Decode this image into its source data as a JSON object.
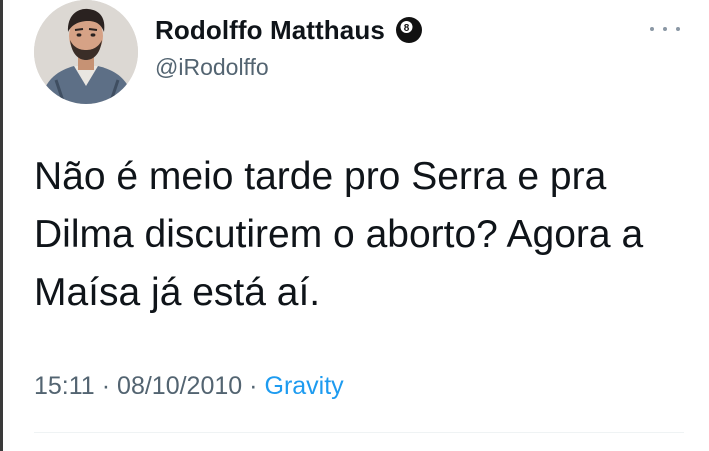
{
  "tweet": {
    "author": {
      "display_name": "Rodolffo Matthaus",
      "handle": "@iRodolffo",
      "badge_icon": "eight-ball-icon",
      "avatar_icon": "profile-photo"
    },
    "text_lines": [
      "Não é meio tarde pro Serra e pra",
      "Dilma discutirem o aborto? Agora a",
      "Maísa já está aí."
    ],
    "time": "15:11",
    "date": "08/10/2010",
    "source": "Gravity",
    "separator": "·",
    "more_icon": "more-horizontal-icon"
  },
  "colors": {
    "text_primary": "#0f1419",
    "text_secondary": "#536471",
    "link": "#1d9bf0",
    "divider": "#eff3f4"
  }
}
